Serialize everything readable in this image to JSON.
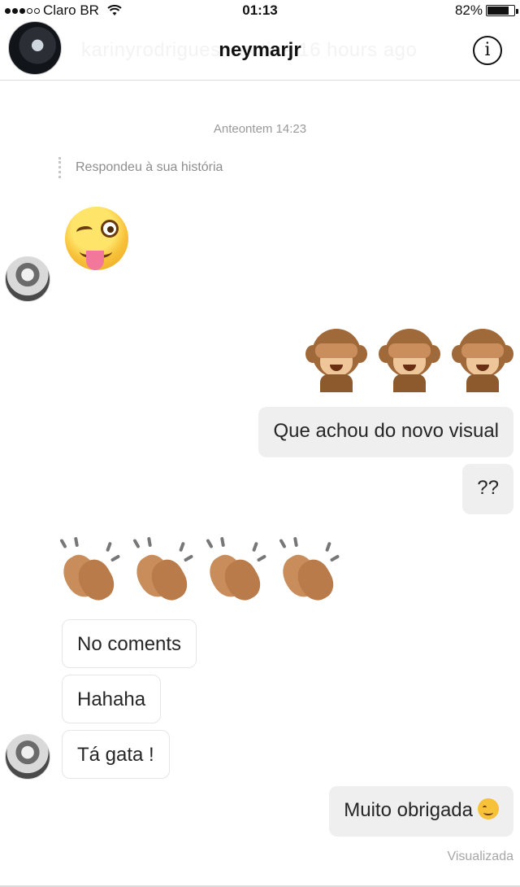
{
  "status_bar": {
    "carrier": "Claro BR",
    "time": "01:13",
    "battery_percent": "82%",
    "battery_level": 0.82,
    "signal_dots_filled": 3,
    "signal_dots_total": 5
  },
  "header": {
    "username": "neymarjr",
    "ghost_text": "karinyrodrigues · active 16 hours ago",
    "info_glyph": "i"
  },
  "thread": {
    "timestamp": "Anteontem 14:23",
    "story_reply_note": "Respondeu à sua história",
    "messages": [
      {
        "from": "them",
        "kind": "emoji",
        "emoji": "winking-face-with-tongue"
      },
      {
        "from": "me",
        "kind": "emoji",
        "emoji": "see-no-evil-monkey",
        "count": 3
      },
      {
        "from": "me",
        "kind": "text",
        "text": "Que achou do novo visual"
      },
      {
        "from": "me",
        "kind": "text",
        "text": "??"
      },
      {
        "from": "them",
        "kind": "emoji",
        "emoji": "clapping-hands",
        "count": 4
      },
      {
        "from": "them",
        "kind": "text",
        "text": "No coments"
      },
      {
        "from": "them",
        "kind": "text",
        "text": "Hahaha"
      },
      {
        "from": "them",
        "kind": "text",
        "text": "Tá gata !"
      },
      {
        "from": "me",
        "kind": "text",
        "text": "Muito obrigada",
        "trailing_emoji": "winking-face"
      }
    ],
    "seen_label": "Visualizada"
  }
}
